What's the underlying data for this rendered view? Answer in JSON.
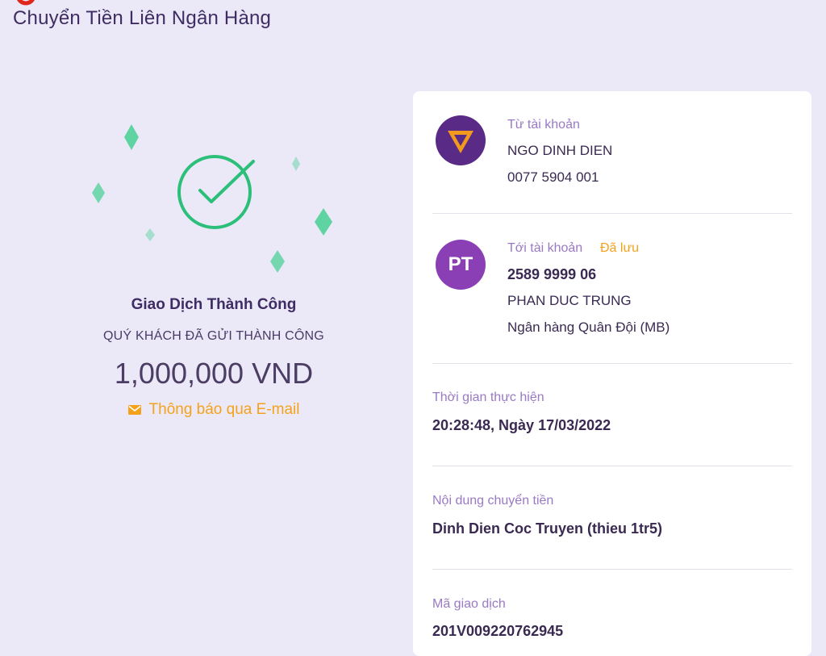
{
  "header": {
    "title": "Chuyển Tiền Liên Ngân Hàng"
  },
  "icons": {
    "corner_logo": "brand-logo-icon",
    "success": "check-circle-icon",
    "email": "envelope-icon",
    "source_bank": "tpbank-logo-icon"
  },
  "colors": {
    "accent": "#f4a21c",
    "success": "#2bbf7a",
    "brand": "#5a2a87",
    "avatar": "#8a3fb5"
  },
  "success": {
    "title": "Giao Dịch Thành Công",
    "subtitle": "QUÝ KHÁCH ĐÃ GỬI THÀNH CÔNG",
    "amount": "1,000,000 VND",
    "email_notice": "Thông báo qua E-mail"
  },
  "from": {
    "label": "Từ tài khoản",
    "name": "NGO DINH DIEN",
    "account": "0077 5904 001"
  },
  "to": {
    "label": "Tới tài khoản",
    "saved": "Đã lưu",
    "initials": "PT",
    "account": "2589 9999 06",
    "name": "PHAN DUC TRUNG",
    "bank": "Ngân hàng Quân Đội (MB)"
  },
  "time": {
    "label": "Thời gian thực hiện",
    "value": "20:28:48, Ngày 17/03/2022"
  },
  "content": {
    "label": "Nội dung chuyển tiền",
    "value": "Dinh Dien Coc Truyen (thieu 1tr5)"
  },
  "transaction": {
    "label": "Mã giao dịch",
    "value": "201V009220762945"
  }
}
